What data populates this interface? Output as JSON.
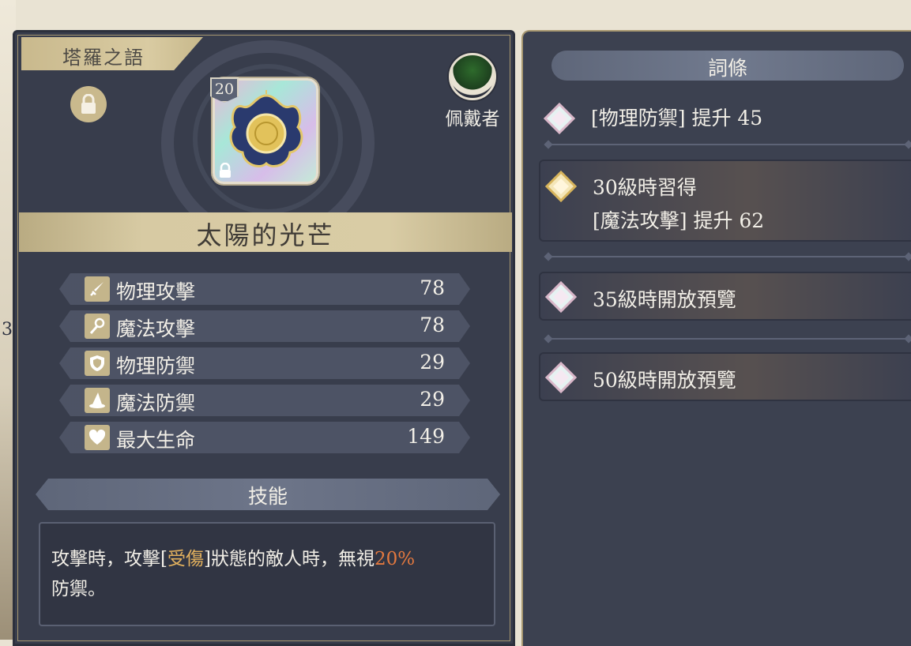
{
  "edge": {
    "number": "3"
  },
  "equipment": {
    "title": "塔羅之語",
    "level": "20",
    "name": "太陽的光芒",
    "wearer_label": "佩戴者"
  },
  "stats": [
    {
      "icon": "sword-icon",
      "name": "物理攻擊",
      "value": "78"
    },
    {
      "icon": "staff-icon",
      "name": "魔法攻擊",
      "value": "78"
    },
    {
      "icon": "shield-icon",
      "name": "物理防禦",
      "value": "29"
    },
    {
      "icon": "wizard-hat-icon",
      "name": "魔法防禦",
      "value": "29"
    },
    {
      "icon": "heart-icon",
      "name": "最大生命",
      "value": "149"
    }
  ],
  "skill": {
    "header": "技能",
    "text_1": "攻擊時，攻擊[",
    "highlight": "受傷",
    "text_2": "]狀態的敵人時，無視",
    "percent": "20%",
    "text_3": "防禦。"
  },
  "affixes": {
    "header": "詞條",
    "items": [
      {
        "line1": "[物理防禦] 提升 45",
        "line2": ""
      },
      {
        "line1": "30級時習得",
        "line2": "[魔法攻擊] 提升 62"
      },
      {
        "line1": "35級時開放預覽",
        "line2": ""
      },
      {
        "line1": "50級時開放預覽",
        "line2": ""
      }
    ]
  },
  "colors": {
    "panel_bg": "#383d4c",
    "gold": "#c9b98d",
    "status_highlight": "#e3b15e",
    "percent_highlight": "#e4793f"
  }
}
